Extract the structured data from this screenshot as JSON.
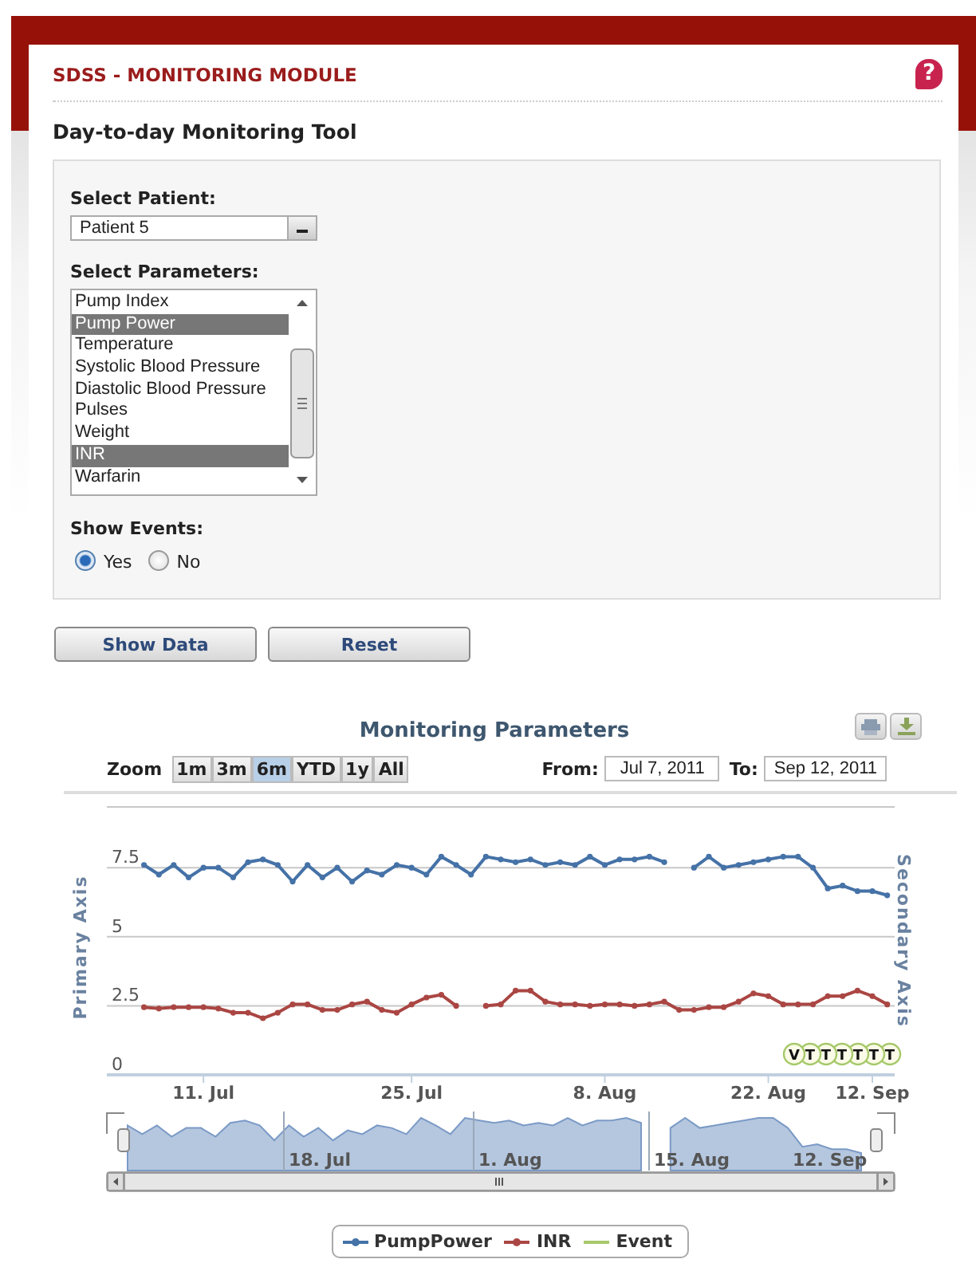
{
  "header": {
    "title": "SDSS - MONITORING MODULE",
    "help": "?"
  },
  "tool_title": "Day-to-day Monitoring Tool",
  "form": {
    "patient": {
      "label": "Select Patient:",
      "value": "Patient 5"
    },
    "parameters": {
      "label": "Select Parameters:",
      "items": [
        {
          "label": "Pump Index",
          "selected": false
        },
        {
          "label": "Pump Power",
          "selected": true
        },
        {
          "label": "Temperature",
          "selected": false
        },
        {
          "label": "Systolic Blood Pressure",
          "selected": false
        },
        {
          "label": "Diastolic Blood Pressure",
          "selected": false
        },
        {
          "label": "Pulses",
          "selected": false
        },
        {
          "label": "Weight",
          "selected": false
        },
        {
          "label": "INR",
          "selected": true
        },
        {
          "label": "Warfarin",
          "selected": false
        }
      ]
    },
    "events": {
      "label": "Show Events:",
      "options": [
        {
          "label": "Yes",
          "selected": true
        },
        {
          "label": "No",
          "selected": false
        }
      ]
    }
  },
  "buttons": [
    "Show Data",
    "Reset"
  ],
  "chart": {
    "zoom_label": "Zoom",
    "zoom_buttons": [
      {
        "label": "1m",
        "selected": false
      },
      {
        "label": "3m",
        "selected": false
      },
      {
        "label": "6m",
        "selected": true
      },
      {
        "label": "YTD",
        "selected": false
      },
      {
        "label": "1y",
        "selected": false
      },
      {
        "label": "All",
        "selected": false
      }
    ],
    "from_label": "From:",
    "from": "Jul 7, 2011",
    "to_label": "To:",
    "to": "Sep 12, 2011",
    "secondary_axis_title": "Secondary Axis",
    "chart_data": {
      "type": "line",
      "title": "Monitoring Parameters",
      "ylabel": "Primary Axis",
      "categories": [
        null,
        null,
        null,
        null,
        "11. Jul",
        null,
        null,
        null,
        null,
        null,
        null,
        null,
        null,
        null,
        null,
        null,
        null,
        null,
        "25. Jul",
        null,
        null,
        null,
        null,
        null,
        null,
        null,
        null,
        null,
        null,
        null,
        null,
        "8. Aug",
        null,
        null,
        null,
        null,
        null,
        null,
        null,
        null,
        null,
        null,
        "22. Aug",
        null,
        null,
        null,
        null,
        null,
        null,
        "12. Sep",
        null
      ],
      "ylim": [
        0,
        9.7
      ],
      "grid": true,
      "legend": true,
      "yticks": [
        0,
        2.5,
        5,
        7.5
      ],
      "series": [
        {
          "name": "PumpPower",
          "color": "#4572a7",
          "marker": "circle",
          "values": [
            7.6,
            7.25,
            7.6,
            7.15,
            7.5,
            7.5,
            7.15,
            7.7,
            7.8,
            7.6,
            7.0,
            7.6,
            7.15,
            7.5,
            7.0,
            7.4,
            7.25,
            7.6,
            7.5,
            7.25,
            7.9,
            7.6,
            7.25,
            7.9,
            7.8,
            7.7,
            7.8,
            7.6,
            7.7,
            7.6,
            7.9,
            7.6,
            7.8,
            7.8,
            7.9,
            7.7,
            null,
            7.5,
            7.9,
            7.5,
            7.6,
            7.7,
            7.8,
            7.9,
            7.9,
            7.5,
            6.75,
            6.85,
            6.65,
            6.65,
            6.5
          ]
        },
        {
          "name": "INR",
          "color": "#aa4643",
          "marker": "circle",
          "values": [
            2.45,
            2.4,
            2.45,
            2.45,
            2.45,
            2.4,
            2.25,
            2.25,
            2.05,
            2.25,
            2.55,
            2.55,
            2.35,
            2.35,
            2.55,
            2.65,
            2.35,
            2.25,
            2.55,
            2.8,
            2.9,
            2.5,
            null,
            2.5,
            2.55,
            3.05,
            3.05,
            2.65,
            2.55,
            2.55,
            2.5,
            2.55,
            2.55,
            2.5,
            2.55,
            2.65,
            2.35,
            2.35,
            2.45,
            2.45,
            2.65,
            2.95,
            2.85,
            2.55,
            2.55,
            2.55,
            2.85,
            2.85,
            3.05,
            2.85,
            2.55
          ]
        }
      ]
    },
    "events": {
      "name": "Event",
      "color": "#a6c96a",
      "flags": [
        "V",
        "T",
        "T",
        "T",
        "T",
        "T",
        "T"
      ]
    },
    "navigator": {
      "labels": [
        "18. Jul",
        "1. Aug",
        "15. Aug",
        "12. Sep"
      ]
    }
  }
}
